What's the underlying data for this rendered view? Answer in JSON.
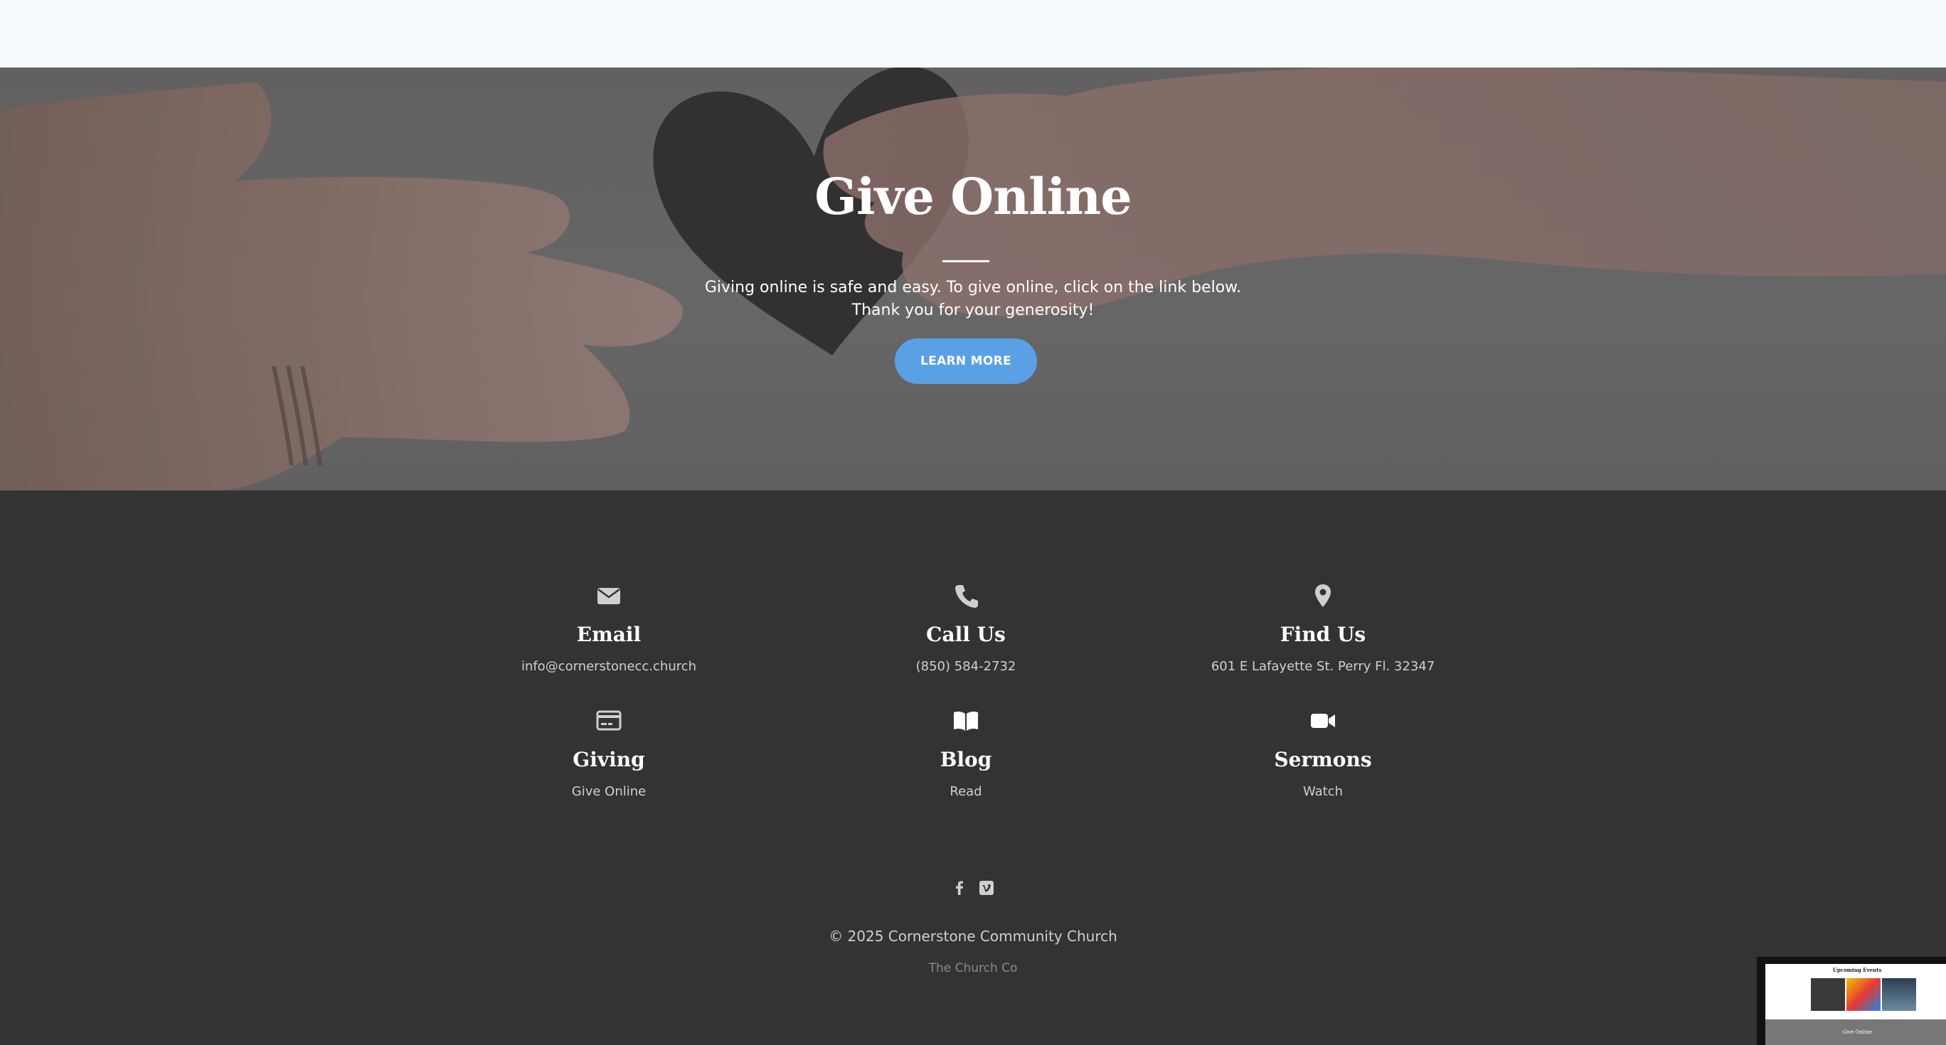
{
  "hero": {
    "title": "Give Online",
    "text_line1": "Giving online is safe and easy. To give online, click on the link below.",
    "text_line2": "Thank you for your generosity!",
    "button_label": "LEARN MORE"
  },
  "contact": {
    "email": {
      "icon": "envelope-icon",
      "title": "Email",
      "link": "info@cornerstonecc.church"
    },
    "call": {
      "icon": "phone-icon",
      "title": "Call Us",
      "link": "(850) 584-2732"
    },
    "find": {
      "icon": "map-pin-icon",
      "title": "Find Us",
      "link": "601 E Lafayette St. Perry Fl. 32347"
    },
    "giving": {
      "icon": "credit-card-icon",
      "title": "Giving",
      "link": "Give Online"
    },
    "blog": {
      "icon": "open-book-icon",
      "title": "Blog",
      "link": "Read"
    },
    "sermons": {
      "icon": "video-camera-icon",
      "title": "Sermons",
      "link": "Watch"
    }
  },
  "social": [
    "facebook-icon",
    "vimeo-icon"
  ],
  "footer": {
    "copyright": "© 2025 Cornerstone Community Church",
    "credit": "The Church Co"
  },
  "preview": {
    "section_title": "Upcoming Events",
    "hero_title": "Give Online"
  },
  "colors": {
    "accent": "#5aa0e4",
    "footer_bg": "#333333",
    "topbar_bg": "#f5fafd"
  }
}
